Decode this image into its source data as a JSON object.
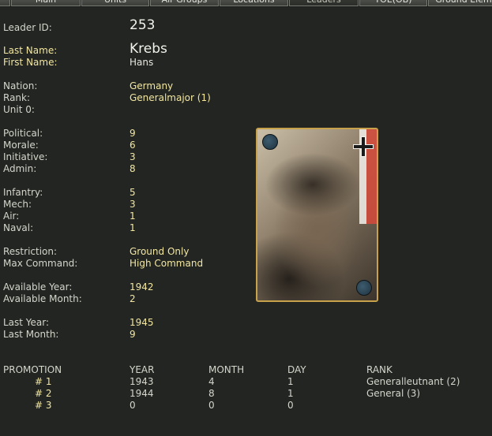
{
  "tabs": [
    {
      "label": "Main",
      "active": false
    },
    {
      "label": "Units",
      "active": false
    },
    {
      "label": "Air Groups",
      "active": false
    },
    {
      "label": "Locations",
      "active": false
    },
    {
      "label": "Leaders",
      "active": true
    },
    {
      "label": "TOE(OB)",
      "active": false
    },
    {
      "label": "Ground Elem",
      "active": false
    }
  ],
  "leader": {
    "id_label": "Leader ID:",
    "id": "253",
    "last_name_label": "Last Name:",
    "last_name": "Krebs",
    "first_name_label": "First Name:",
    "first_name": "Hans",
    "nation_label": "Nation:",
    "nation": "Germany",
    "rank_label": "Rank:",
    "rank": "Generalmajor (1)",
    "unit_label": "Unit 0:",
    "unit": "",
    "political_label": "Political:",
    "political": "9",
    "morale_label": "Morale:",
    "morale": "6",
    "initiative_label": "Initiative:",
    "initiative": "3",
    "admin_label": "Admin:",
    "admin": "8",
    "infantry_label": "Infantry:",
    "infantry": "5",
    "mech_label": "Mech:",
    "mech": "3",
    "air_label": "Air:",
    "air": "1",
    "naval_label": "Naval:",
    "naval": "1",
    "restriction_label": "Restriction:",
    "restriction": "Ground Only",
    "max_command_label": "Max Command:",
    "max_command": "High Command",
    "available_year_label": "Available Year:",
    "available_year": "1942",
    "available_month_label": "Available Month:",
    "available_month": "2",
    "last_year_label": "Last Year:",
    "last_year": "1945",
    "last_month_label": "Last Month:",
    "last_month": "9"
  },
  "promotion": {
    "headers": {
      "promotion": "PROMOTION",
      "year": "YEAR",
      "month": "MONTH",
      "day": "DAY",
      "rank": "RANK"
    },
    "rows": [
      {
        "num": "# 1",
        "year": "1943",
        "month": "4",
        "day": "1",
        "rank": "Generalleutnant (2)"
      },
      {
        "num": "# 2",
        "year": "1944",
        "month": "8",
        "day": "1",
        "rank": "General (3)"
      },
      {
        "num": "# 3",
        "year": "0",
        "month": "0",
        "day": "0",
        "rank": ""
      }
    ]
  },
  "portrait": {
    "icons": [
      "iron-cross-icon",
      "flag-stripe",
      "corner-dot-icon"
    ],
    "colors": {
      "frame": "#c8a24a",
      "flag_red": "#d64a3a",
      "dot": "#2c4a5a"
    }
  }
}
